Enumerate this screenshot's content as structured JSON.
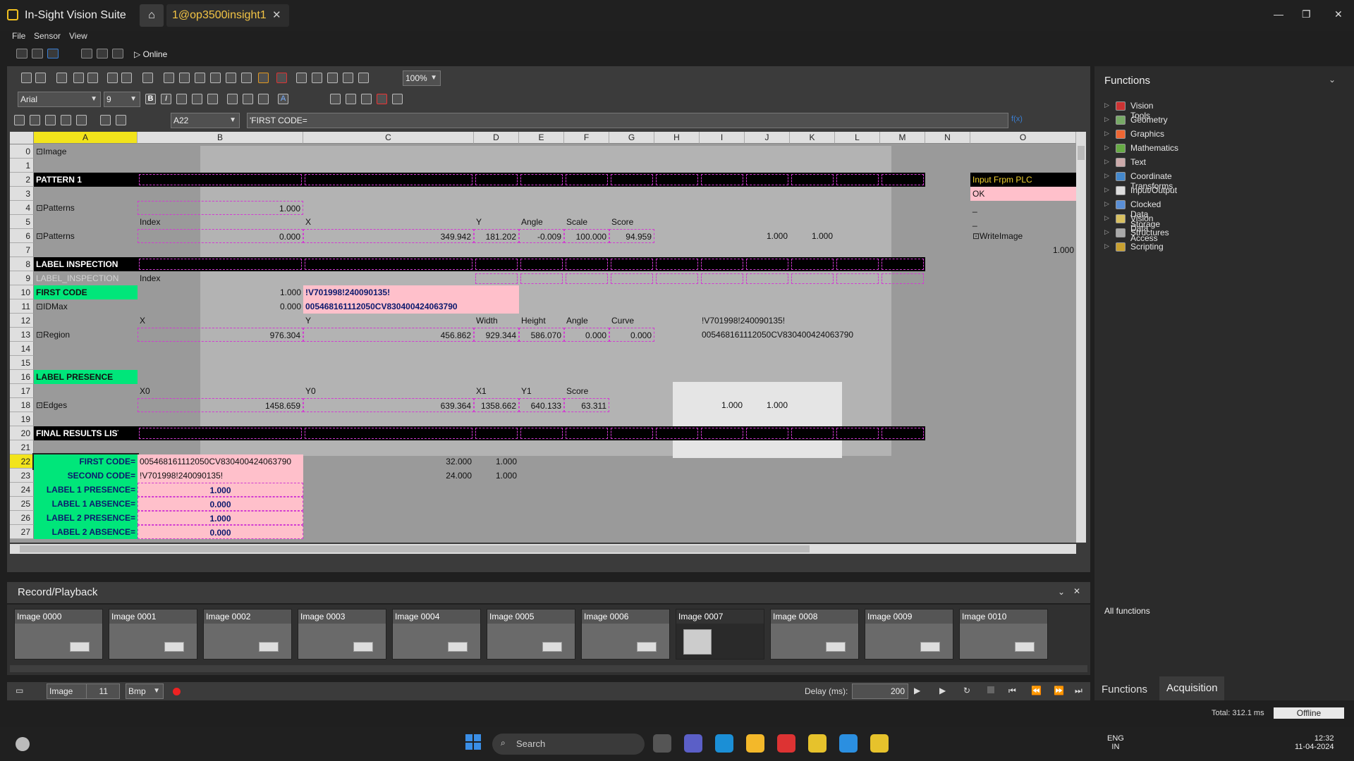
{
  "app": {
    "title": "In-Sight Vision Suite",
    "tab": "1@op3500insight1",
    "home_icon": "home-icon"
  },
  "menu": [
    "File",
    "Sensor",
    "View"
  ],
  "toolbar": {
    "online_label": "Online",
    "zoom": "100%"
  },
  "format": {
    "font": "Arial",
    "size": "9",
    "cell_ref": "A22",
    "formula": "'FIRST  CODE=",
    "fx_label": "f(x)"
  },
  "columns": [
    "A",
    "B",
    "C",
    "D",
    "E",
    "F",
    "G",
    "H",
    "I",
    "J",
    "K",
    "L",
    "M",
    "N",
    "O"
  ],
  "rows": [
    "0",
    "1",
    "2",
    "3",
    "4",
    "5",
    "6",
    "7",
    "8",
    "9",
    "10",
    "11",
    "12",
    "13",
    "14",
    "15",
    "16",
    "17",
    "18",
    "19",
    "20",
    "21",
    "22",
    "23",
    "24",
    "25",
    "26",
    "27"
  ],
  "cells": {
    "a0": "⊡Image",
    "a2": "PATTERN 1",
    "a4": "⊡Patterns",
    "b4": "1.000",
    "b5": "Index",
    "c5": "X",
    "d5": "Y",
    "e5": "Angle",
    "f5": "Scale",
    "g5": "Score",
    "a6": "⊡Patterns",
    "b6": "0.000",
    "c6": "349.942",
    "d6": "181.202",
    "e6": "-0.009",
    "f6": "100.000",
    "g6": "94.959",
    "j6": "1.000",
    "k6": "1.000",
    "a8": "LABEL INSPECTION",
    "a9": "LABEL_INSPECTION",
    "b9": "Index",
    "a10": "FIRST  CODE",
    "b10": "1.000",
    "c10": "!V701998!240090135!",
    "a11": "⊡IDMax",
    "b11": "0.000",
    "c11": "005468161112050CV830400424063790",
    "b12": "X",
    "c12": "Y",
    "d12": "Width",
    "e12": "Height",
    "f12": "Angle",
    "g12": "Curve",
    "i12": "!V701998!240090135!",
    "a13": "⊡Region",
    "b13": "976.304",
    "c13": "456.862",
    "d13": "929.344",
    "e13": "586.070",
    "f13": "0.000",
    "g13": "0.000",
    "i13": "005468161112050CV830400424063790",
    "a16": "LABEL PRESENCE",
    "b17": "X0",
    "c17": "Y0",
    "d17": "X1",
    "e17": "Y1",
    "f17": "Score",
    "a18": "⊡Edges",
    "b18": "1458.659",
    "c18": "639.364",
    "d18": "1358.662",
    "e18": "640.133",
    "f18": "63.311",
    "i18": "1.000",
    "j18": "1.000",
    "a20": "FINAL RESULTS LIST",
    "a22": "FIRST  CODE=",
    "b22": "005468161112050CV830400424063790",
    "c22": "32.000",
    "d22": "1.000",
    "a23": "SECOND  CODE=",
    "b23": "!V701998!240090135!",
    "c23": "24.000",
    "d23": "1.000",
    "a24": "LABEL 1 PRESENCE=",
    "b24": "1.000",
    "a25": "LABEL 1 ABSENCE=",
    "b25": "0.000",
    "a26": "LABEL 2 PRESENCE=",
    "b26": "1.000",
    "a27": "LABEL 2 ABSENCE=",
    "b27": "0.000",
    "o2": "Input Frpm PLC",
    "o3": "OK",
    "o4": "_",
    "o5": "_",
    "o6": "⊡WriteImage",
    "o7": "1.000"
  },
  "record": {
    "title": "Record/Playback",
    "thumbnails": [
      "Image 0000",
      "Image 0001",
      "Image 0002",
      "Image 0003",
      "Image 0004",
      "Image 0005",
      "Image 0006",
      "Image 0007",
      "Image 0008",
      "Image 0009",
      "Image 0010"
    ],
    "mode": "Image",
    "count": "11",
    "format": "Bmp",
    "delay_label": "Delay (ms):",
    "delay": "200"
  },
  "functions": {
    "title": "Functions",
    "items": [
      "Vision Tools",
      "Geometry",
      "Graphics",
      "Mathematics",
      "Text",
      "Coordinate Transforms",
      "Input/Output",
      "Clocked Data Storage",
      "Vision Data Access",
      "Structures",
      "Scripting"
    ],
    "all_label": "All functions",
    "tabs": [
      "Functions",
      "Acquisition"
    ]
  },
  "status": {
    "total": "Total: 312.1 ms",
    "offline": "Offline"
  },
  "taskbar": {
    "search": "Search",
    "lang": "ENG",
    "region": "IN",
    "time": "12:32",
    "date": "11-04-2024"
  }
}
